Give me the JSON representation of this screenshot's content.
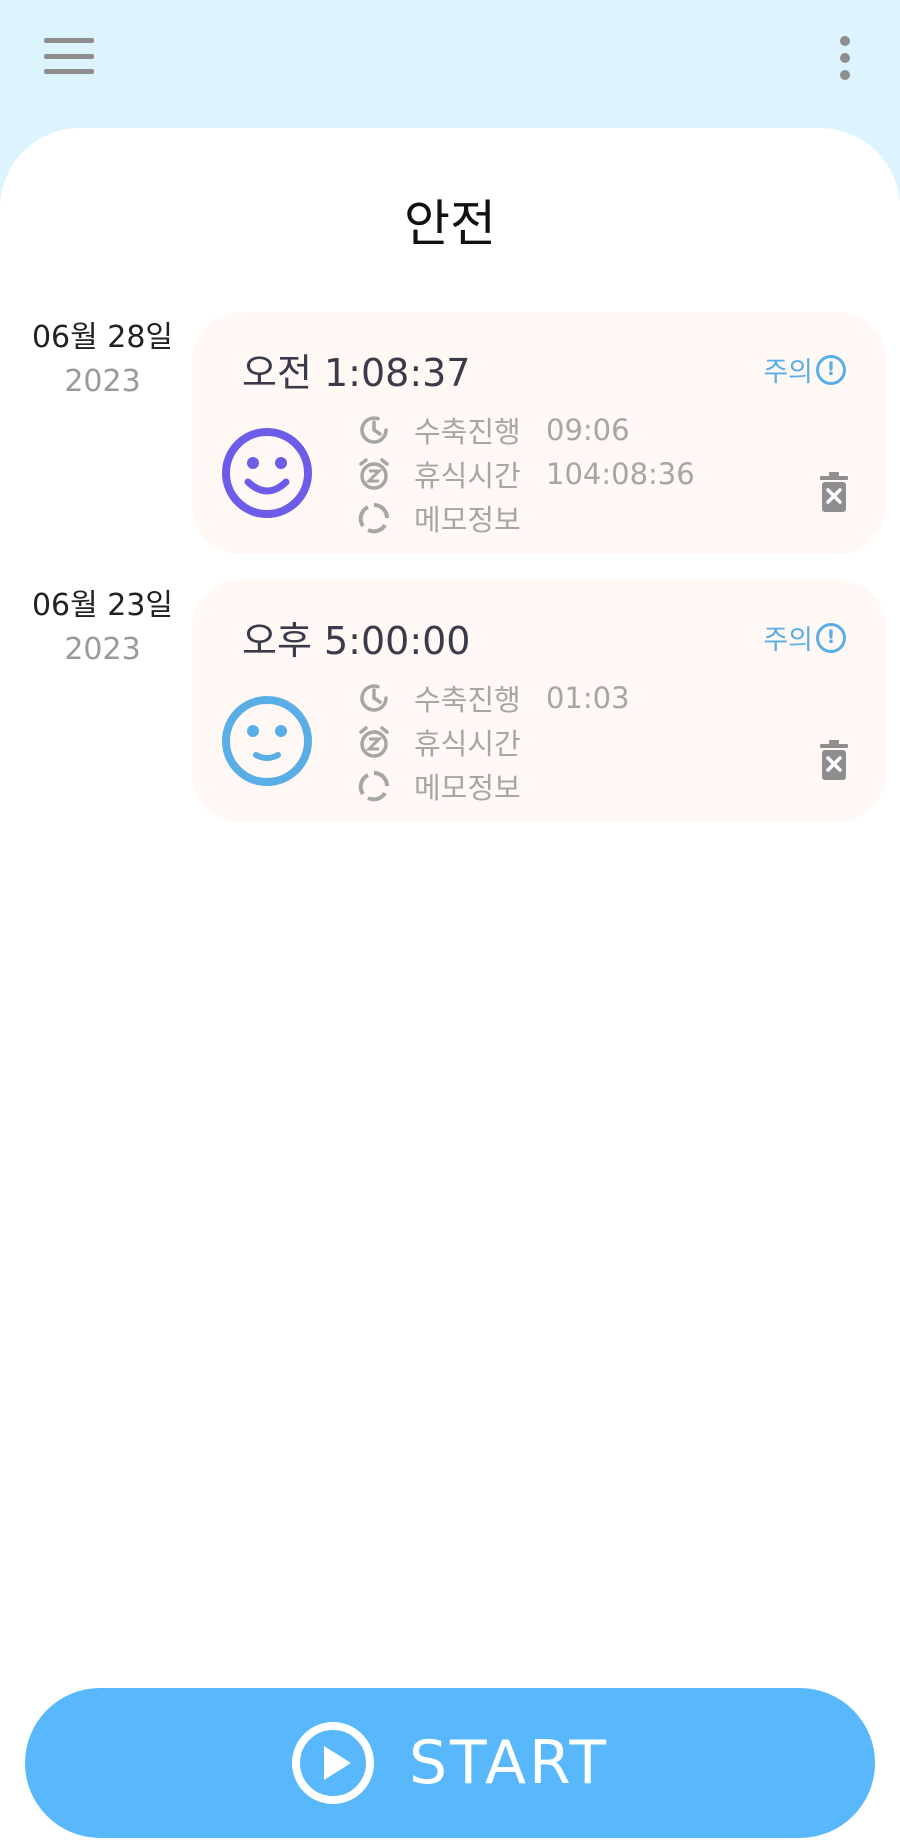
{
  "header": {
    "menu_icon": "hamburger-menu-icon",
    "more_icon": "more-vertical-icon"
  },
  "page": {
    "title": "안전"
  },
  "entries": [
    {
      "date": "06월 28일",
      "year": "2023",
      "time": "오전 1:08:37",
      "warning_label": "주의",
      "face_color": "#6c5ce7",
      "face_icon": "smile-face-icon",
      "rows": [
        {
          "icon": "clock-icon",
          "label": "수축진행",
          "value": "09:06"
        },
        {
          "icon": "alarm-snooze-icon",
          "label": "휴식시간",
          "value": "104:08:36"
        },
        {
          "icon": "memo-circle-icon",
          "label": "메모정보",
          "value": ""
        }
      ]
    },
    {
      "date": "06월 23일",
      "year": "2023",
      "time": "오후 5:00:00",
      "warning_label": "주의",
      "face_color": "#5aaee6",
      "face_icon": "slight-smile-face-icon",
      "rows": [
        {
          "icon": "clock-icon",
          "label": "수축진행",
          "value": "01:03"
        },
        {
          "icon": "alarm-snooze-icon",
          "label": "휴식시간",
          "value": ""
        },
        {
          "icon": "memo-circle-icon",
          "label": "메모정보",
          "value": ""
        }
      ]
    }
  ],
  "start_button": {
    "label": "START",
    "icon": "play-circle-icon"
  },
  "colors": {
    "header_bg": "#ddf4fe",
    "card_bg": "#fff8f4",
    "accent": "#58b8fb",
    "warning": "#5aaee6"
  }
}
